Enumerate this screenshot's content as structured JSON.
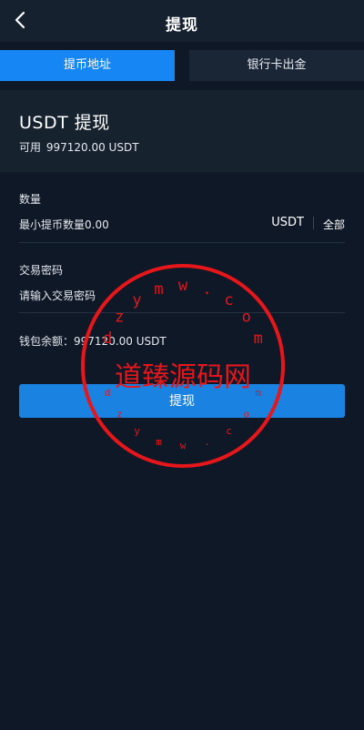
{
  "header": {
    "title": "提现",
    "back_icon": "chevron-left-icon"
  },
  "tabs": [
    {
      "label": "提币地址",
      "active": true
    },
    {
      "label": "银行卡出金",
      "active": false
    }
  ],
  "coin": {
    "title": "USDT 提现",
    "available_label": "可用",
    "available_value": "997120.00 USDT"
  },
  "amount": {
    "label": "数量",
    "placeholder": "最小提币数量0.00",
    "unit": "USDT",
    "all_label": "全部"
  },
  "password": {
    "label": "交易密码",
    "placeholder": "请输入交易密码"
  },
  "wallet": {
    "label": "钱包余额：",
    "value": "997120.00 USDT"
  },
  "submit_label": "提现",
  "watermark": {
    "center_text": "道臻源码网",
    "ring_text": "dzymw.com",
    "color": "#e6161b"
  },
  "colors": {
    "background": "#0e1826",
    "accent": "#1686f5",
    "button": "#1a82e0"
  }
}
